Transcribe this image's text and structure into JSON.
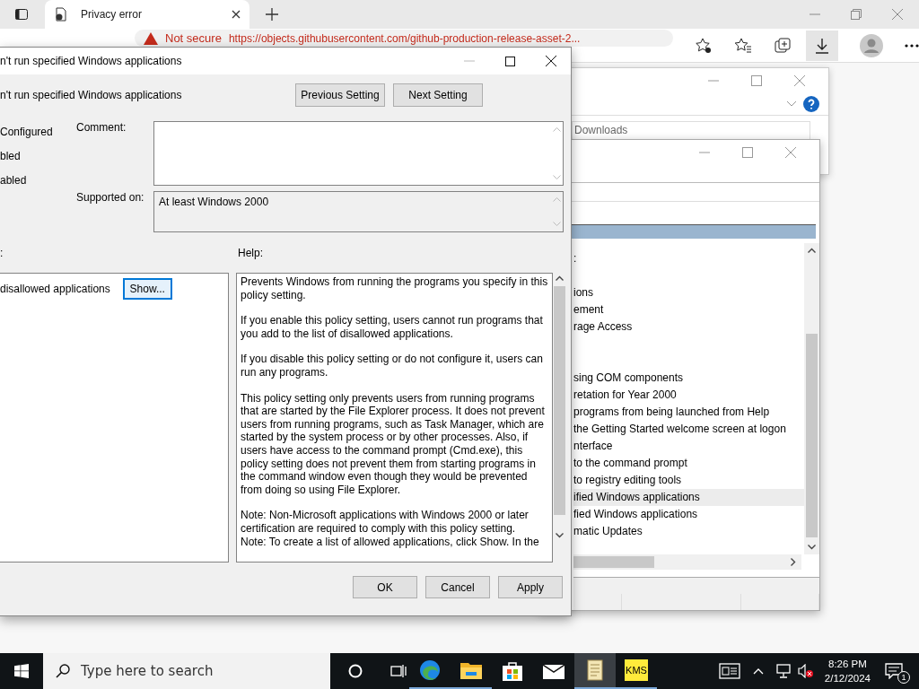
{
  "browser": {
    "tab_title": "Privacy error",
    "security": "Not secure",
    "url": "https://objects.githubusercontent.com/github-production-release-asset-2..."
  },
  "back_window": {
    "address": "Downloads",
    "items": [
      {
        "label": ":",
        "selected": false
      },
      {
        "selected": false
      },
      {
        "label": "ions",
        "selected": false
      },
      {
        "label": "ement",
        "selected": false
      },
      {
        "label": "rage Access",
        "selected": false
      },
      {
        "selected": false
      },
      {
        "selected": false
      },
      {
        "label": "sing COM components",
        "selected": false
      },
      {
        "label": "retation for Year 2000",
        "selected": false
      },
      {
        "label": "programs from being launched from Help",
        "selected": false
      },
      {
        "label": "the Getting Started welcome screen at logon",
        "selected": false
      },
      {
        "label": "nterface",
        "selected": false
      },
      {
        "label": "to the command prompt",
        "selected": false
      },
      {
        "label": "to registry editing tools",
        "selected": false
      },
      {
        "label": "ified Windows applications",
        "selected": true
      },
      {
        "label": "fied Windows applications",
        "selected": false
      },
      {
        "label": "matic Updates",
        "selected": false
      }
    ]
  },
  "dialog": {
    "title": "n't run specified Windows applications",
    "heading": "n't run specified Windows applications",
    "nav_buttons": [
      "Previous Setting",
      "Next Setting"
    ],
    "states": [
      "Configured",
      "bled",
      "abled"
    ],
    "comment_label": "Comment:",
    "supported_label": "Supported on:",
    "supported_value": "At least Windows 2000",
    "options_label": ":",
    "help_label": "Help:",
    "option": {
      "label": "disallowed applications",
      "button": "Show..."
    },
    "help_paragraphs": [
      "Prevents Windows from running the programs you specify in this policy setting.",
      "If you enable this policy setting, users cannot run programs that you add to the list of disallowed applications.",
      "If you disable this policy setting or do not configure it, users can run any programs.",
      "This policy setting only prevents users from running programs that are started by the File Explorer process. It does not prevent users from running programs, such as Task Manager, which are started by the system process or by other processes.  Also, if users have access to the command prompt (Cmd.exe), this policy setting does not prevent them from starting programs in the command window even though they would be prevented from doing so using File Explorer."
    ],
    "help_notes": [
      "Note: Non-Microsoft applications with Windows 2000 or later certification are required to comply with this policy setting.",
      "Note: To create a list of allowed applications, click Show.  In the"
    ],
    "buttons": [
      "OK",
      "Cancel",
      "Apply"
    ]
  },
  "taskbar": {
    "search_placeholder": "Type here to search",
    "kms": "KMS",
    "time": "8:26 PM",
    "date": "2/12/2024",
    "notifications": "1"
  }
}
